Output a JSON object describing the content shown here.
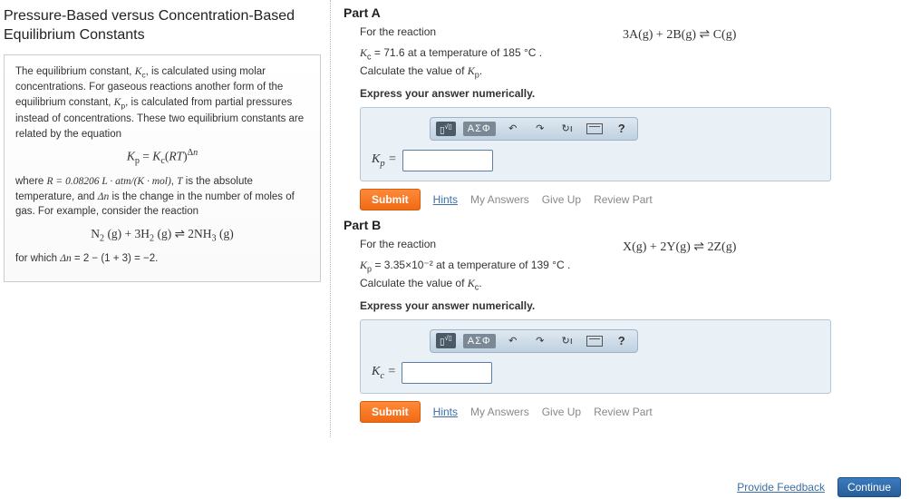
{
  "left": {
    "title": "Pressure-Based versus Concentration-Based Equilibrium Constants",
    "para1_a": "The equilibrium constant, ",
    "para1_kc": "K",
    "para1_kc_sub": "c",
    "para1_b": ", is calculated using molar concentrations. For gaseous reactions another form of the equilibrium constant, ",
    "para1_kp": "K",
    "para1_kp_sub": "p",
    "para1_c": ", is calculated from partial pressures instead of concentrations. These two equilibrium constants are related by the equation",
    "eq1": "Kp = Kc(RT)Δn",
    "para2_a": "where ",
    "para2_r": "R = 0.08206 L · atm/(K · mol)",
    "para2_b": ", ",
    "para2_t": "T",
    "para2_c": " is the absolute temperature, and ",
    "para2_dn": "Δn",
    "para2_d": " is the change in the number of moles of gas. For example, consider the reaction",
    "eq2": "N2 (g) + 3H2 (g) ⇌ 2NH3 (g)",
    "para3_a": "for which ",
    "para3_b": "Δn = 2 − (1 + 3) = −2."
  },
  "partA": {
    "header": "Part A",
    "for_the_reaction": "For the reaction",
    "reaction": "3A(g) + 2B(g) ⇌ C(g)",
    "line1_a": "K",
    "line1_a_sub": "c",
    "line1_b": " = 71.6 at a temperature of 185 °C .",
    "line2_a": "Calculate the value of ",
    "line2_k": "K",
    "line2_k_sub": "p",
    "line2_b": ".",
    "express": "Express your answer numerically.",
    "toolbar_sigma": "ΑΣΦ",
    "input_label_k": "K",
    "input_label_sub": "p",
    "input_label_eq": " = ",
    "submit": "Submit",
    "hints": "Hints",
    "my_answers": "My Answers",
    "give_up": "Give Up",
    "review": "Review Part"
  },
  "partB": {
    "header": "Part B",
    "for_the_reaction": "For the reaction",
    "reaction": "X(g) + 2Y(g) ⇌ 2Z(g)",
    "line1_a": "K",
    "line1_a_sub": "p",
    "line1_b": " = 3.35×10⁻² at a temperature of 139 °C .",
    "line2_a": "Calculate the value of ",
    "line2_k": "K",
    "line2_k_sub": "c",
    "line2_b": ".",
    "express": "Express your answer numerically.",
    "toolbar_sigma": "ΑΣΦ",
    "input_label_k": "K",
    "input_label_sub": "c",
    "input_label_eq": " = ",
    "submit": "Submit",
    "hints": "Hints",
    "my_answers": "My Answers",
    "give_up": "Give Up",
    "review": "Review Part"
  },
  "footer": {
    "feedback": "Provide Feedback",
    "continue": "Continue"
  }
}
